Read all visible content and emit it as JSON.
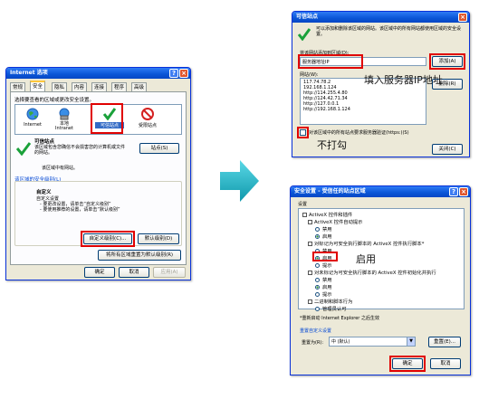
{
  "left_dialog": {
    "title": "Internet 选项",
    "tabs": [
      "常规",
      "安全",
      "隐私",
      "内容",
      "连接",
      "程序",
      "高级"
    ],
    "zone_prompt": "选择要查看的区域或更改安全设置。",
    "zones": [
      "Internet",
      "本地\nIntranet",
      "可信站点",
      "受限站点"
    ],
    "zone_heading": "可信站点",
    "zone_desc": "该区域包含您确信不会损害您的计算机或文件的网站。",
    "zone_note": "该区域中有网站。",
    "sites_button": "站点(S)",
    "security_level_heading": "该区域的安全级别(L)",
    "custom_heading": "自定义",
    "custom_lines": [
      "自定义设置",
      "- 要更改设置，请单击“自定义级别”",
      "- 要使用推荐的设置，请单击“默认级别”"
    ],
    "custom_level_button": "自定义级别(C)...",
    "default_level_button": "默认级别(D)",
    "reset_all_button": "将所有区域重置为默认级别(R)",
    "ok_button": "确定",
    "cancel_button": "取消",
    "apply_button": "应用(A)"
  },
  "trusted_dialog": {
    "title": "可信站点",
    "info": "可以添加和删除该区域的网站。该区域中的所有网站都使用区域的安全设置。",
    "add_label": "将该网站添加到区域(D):",
    "input_value": "服务器地址IP",
    "add_button": "添加(A)",
    "sites_label": "网站(W):",
    "sites": [
      "117.74.78.2",
      "192.168.1.124",
      "http://114.255.4.80",
      "http://124.42.71.34",
      "http://127.0.0.1",
      "http://192.168.1.124"
    ],
    "remove_button": "删除(R)",
    "https_checkbox": "对该区域中的所有站点要求服务器验证(https:)(S)",
    "close_button": "关闭(C)"
  },
  "security_dialog": {
    "title": "安全设置 - 受信任的站点区域",
    "settings_label": "设置",
    "tree": [
      "ActiveX 控件和插件",
      "ActiveX 控件自动提示",
      "禁用",
      "启用",
      "对标记为可安全执行脚本的 ActiveX 控件执行脚本*",
      "禁用",
      "启用",
      "提示",
      "对未标记为可安全执行脚本的 ActiveX 控件初始化并执行",
      "禁用",
      "启用",
      "提示",
      "二进制和脚本行为",
      "管理员认可"
    ],
    "restart_note": "*重新启动 Internet Explorer 之后生效",
    "reset_heading": "重置自定义设置",
    "reset_to_label": "重置为(R):",
    "reset_select": "中 (默认)",
    "reset_button": "重置(E)...",
    "ok_button": "确定",
    "cancel_button": "取消"
  },
  "annotations": {
    "fill_ip": "填入服务器IP地址",
    "no_check": "不打勾",
    "enable": "启用"
  },
  "colors": {
    "highlight_red": "#e00000",
    "arrow_teal": "#1fb3c4",
    "xp_title_blue": "#0a55d6"
  }
}
